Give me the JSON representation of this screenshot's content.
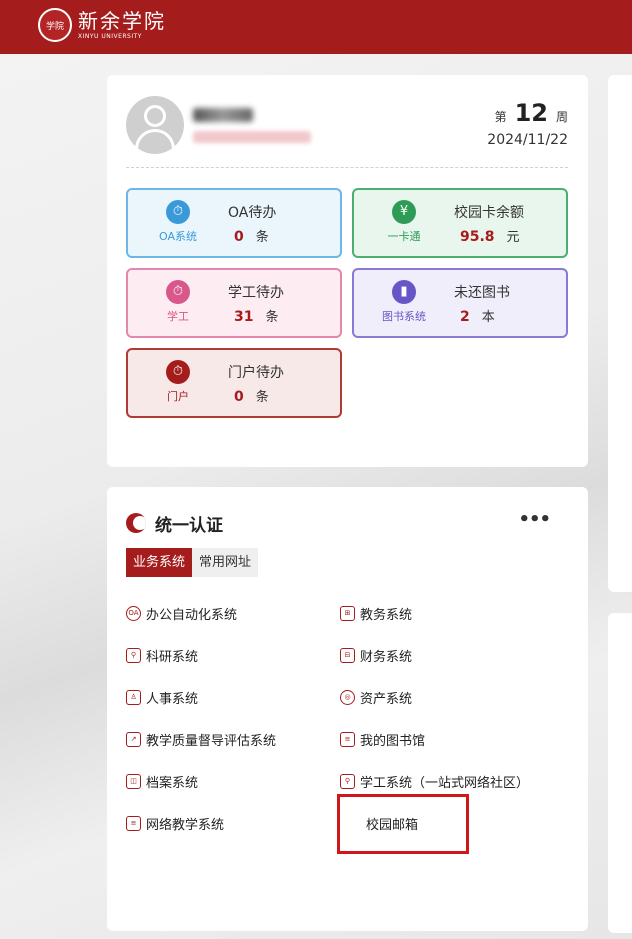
{
  "header": {
    "logo_cn": "新余学院",
    "logo_en": "XINYU UNIVERSITY",
    "seal_text": "学院"
  },
  "profile": {
    "week_prefix": "第",
    "week_number": "12",
    "week_suffix": "周",
    "date": "2024/11/22"
  },
  "stats": [
    {
      "system": "OA系统",
      "title": "OA待办",
      "value": "0",
      "unit": "条",
      "icon": "stopwatch-icon",
      "glyph": "⏱",
      "color": "#3a9ad9",
      "bg": "#eaf5fc",
      "border": "#6cb7e6"
    },
    {
      "system": "一卡通",
      "title": "校园卡余额",
      "value": "95.8",
      "unit": "元",
      "icon": "money-bag-icon",
      "glyph": "¥",
      "color": "#2e9b56",
      "bg": "#e9f6ee",
      "border": "#4cae6f"
    },
    {
      "system": "学工",
      "title": "学工待办",
      "value": "31",
      "unit": "条",
      "icon": "stopwatch-icon",
      "glyph": "⏱",
      "color": "#d9578a",
      "bg": "#fdedf3",
      "border": "#e387ac"
    },
    {
      "system": "图书系统",
      "title": "未还图书",
      "value": "2",
      "unit": "本",
      "icon": "book-icon",
      "glyph": "▮",
      "color": "#6756c8",
      "bg": "#f1eefb",
      "border": "#8a7ad4"
    },
    {
      "system": "门户",
      "title": "门户待办",
      "value": "0",
      "unit": "条",
      "icon": "stopwatch-icon",
      "glyph": "⏱",
      "color": "#a51c1c",
      "bg": "#f7e9e8",
      "border": "#b03a34"
    }
  ],
  "auth": {
    "title": "统一认证",
    "more": "•••",
    "tabs": [
      "业务系统",
      "常用网址"
    ],
    "systems": [
      {
        "label": "办公自动化系统",
        "icon": "oa-icon",
        "glyph": "OA"
      },
      {
        "label": "教务系统",
        "icon": "grid-icon",
        "glyph": "⊞"
      },
      {
        "label": "科研系统",
        "icon": "network-icon",
        "glyph": "⚲"
      },
      {
        "label": "财务系统",
        "icon": "finance-icon",
        "glyph": "⊟"
      },
      {
        "label": "人事系统",
        "icon": "person-icon",
        "glyph": "♙"
      },
      {
        "label": "资产系统",
        "icon": "asset-icon",
        "glyph": "◎"
      },
      {
        "label": "教学质量督导评估系统",
        "icon": "chart-icon",
        "glyph": "↗"
      },
      {
        "label": "我的图书馆",
        "icon": "library-icon",
        "glyph": "≡"
      },
      {
        "label": "档案系统",
        "icon": "archive-icon",
        "glyph": "◫"
      },
      {
        "label": "学工系统（一站式网络社区）",
        "icon": "community-icon",
        "glyph": "⚲"
      },
      {
        "label": "网络教学系统",
        "icon": "document-icon",
        "glyph": "≡"
      },
      {
        "label": "校园邮箱",
        "icon": "",
        "glyph": ""
      }
    ]
  }
}
